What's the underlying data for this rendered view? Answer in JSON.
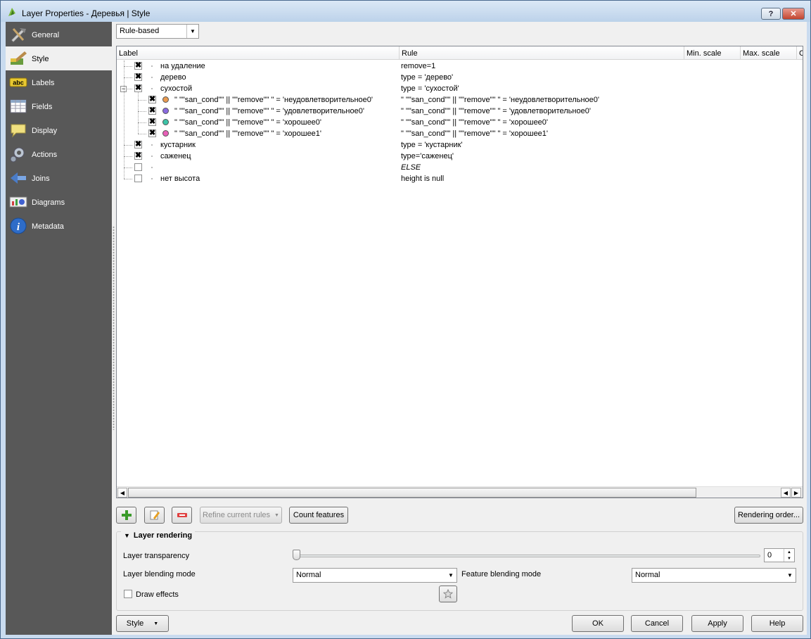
{
  "window": {
    "title": "Layer Properties - Деревья | Style",
    "help_label": "?",
    "close_label": "✕"
  },
  "sidebar": {
    "items": [
      {
        "label": "General",
        "icon": "general-icon"
      },
      {
        "label": "Style",
        "icon": "style-icon",
        "selected": true
      },
      {
        "label": "Labels",
        "icon": "labels-icon"
      },
      {
        "label": "Fields",
        "icon": "fields-icon"
      },
      {
        "label": "Display",
        "icon": "display-icon"
      },
      {
        "label": "Actions",
        "icon": "actions-icon"
      },
      {
        "label": "Joins",
        "icon": "joins-icon"
      },
      {
        "label": "Diagrams",
        "icon": "diagrams-icon"
      },
      {
        "label": "Metadata",
        "icon": "metadata-icon"
      }
    ],
    "icon_text_labels": "abc"
  },
  "renderer": {
    "selected": "Rule-based"
  },
  "tree": {
    "columns": [
      "Label",
      "Rule",
      "Min. scale",
      "Max. scale",
      "C"
    ],
    "rows": [
      {
        "label": "на удаление",
        "rule": "remove=1",
        "checked": true,
        "level": 0
      },
      {
        "label": "дерево",
        "rule": "type = 'дерево'",
        "checked": true,
        "level": 0
      },
      {
        "label": "сухостой",
        "rule": "type = 'сухостой'",
        "checked": true,
        "level": 0,
        "expanded": true
      },
      {
        "label": "\" \"\"san_cond\"\"  ||  \"\"remove\"\" \" = 'неудовлетворительное0'",
        "rule": "\" \"\"san_cond\"\"  ||  \"\"remove\"\" \" = 'неудовлетворительное0'",
        "checked": true,
        "level": 1,
        "color": "#e89a50"
      },
      {
        "label": "\" \"\"san_cond\"\"  ||  \"\"remove\"\" \" = 'удовлетворительное0'",
        "rule": "\" \"\"san_cond\"\"  ||  \"\"remove\"\" \" = 'удовлетворительное0'",
        "checked": true,
        "level": 1,
        "color": "#8a6ae0"
      },
      {
        "label": "\" \"\"san_cond\"\"  ||  \"\"remove\"\" \" = 'хорошее0'",
        "rule": "\" \"\"san_cond\"\"  ||  \"\"remove\"\" \" = 'хорошее0'",
        "checked": true,
        "level": 1,
        "color": "#3cc4a8"
      },
      {
        "label": "\" \"\"san_cond\"\"  ||  \"\"remove\"\" \" = 'хорошее1'",
        "rule": "\" \"\"san_cond\"\"  ||  \"\"remove\"\" \" = 'хорошее1'",
        "checked": true,
        "level": 1,
        "color": "#e860b8"
      },
      {
        "label": "кустарник",
        "rule": "type = 'кустарник'",
        "checked": true,
        "level": 0
      },
      {
        "label": "саженец",
        "rule": "type='саженец'",
        "checked": true,
        "level": 0
      },
      {
        "label": "",
        "rule": "ELSE",
        "checked": false,
        "level": 0,
        "italic": true
      },
      {
        "label": "нет высота",
        "rule": "height is null",
        "checked": false,
        "level": 0
      }
    ]
  },
  "toolbar": {
    "add_icon": "add-rule-icon",
    "edit_icon": "edit-rule-icon",
    "remove_icon": "remove-rule-icon",
    "refine_label": "Refine current rules",
    "count_label": "Count features",
    "rendering_order_label": "Rendering order..."
  },
  "layer_rendering": {
    "title": "Layer rendering",
    "transparency_label": "Layer transparency",
    "transparency_value": "0",
    "blending_label": "Layer blending mode",
    "blending_value": "Normal",
    "feature_blending_label": "Feature blending mode",
    "feature_blending_value": "Normal",
    "draw_effects_label": "Draw effects"
  },
  "footer": {
    "style_label": "Style",
    "ok_label": "OK",
    "cancel_label": "Cancel",
    "apply_label": "Apply",
    "help_label": "Help"
  }
}
